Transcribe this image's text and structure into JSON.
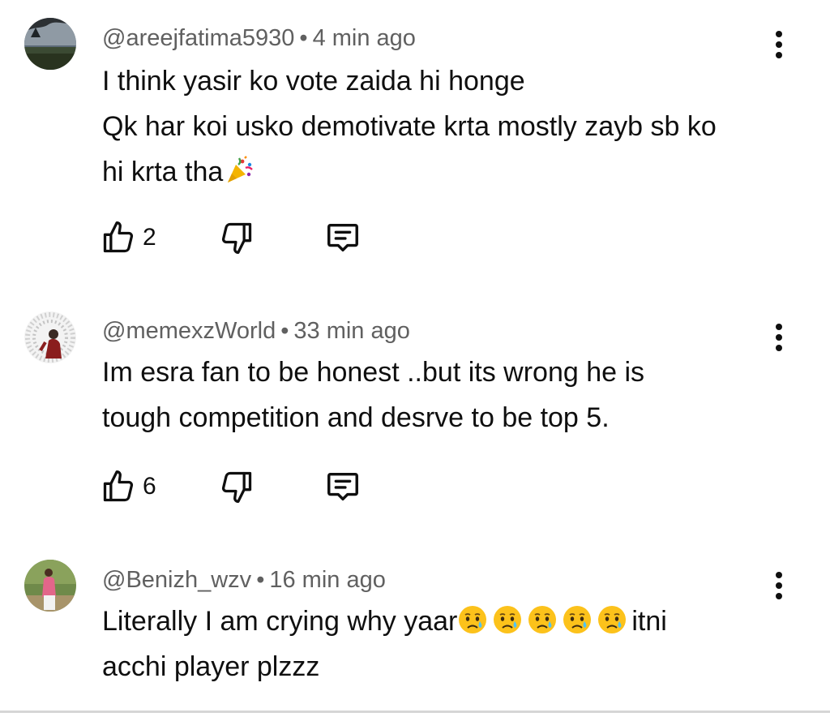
{
  "comments": [
    {
      "author": "@areejfatima5930",
      "time": "4 min ago",
      "lines": [
        "I think yasir ko vote zaida hi honge",
        "Qk har koi usko demotivate krta mostly zayb sb ko",
        "hi krta tha"
      ],
      "trailing_emoji": "party-popper",
      "likes": "2"
    },
    {
      "author": "@memexzWorld",
      "time": "33 min ago",
      "lines": [
        "Im esra fan to be honest ..but its wrong he is",
        "tough competition and desrve to be top 5."
      ],
      "likes": "6"
    },
    {
      "author": "@Benizh_wzv",
      "time": "16 min ago",
      "line1_before": "Literally I am crying why yaar",
      "line1_emoji": "crying-face",
      "line1_emoji_count": 5,
      "line1_after": "itni",
      "line2": "acchi player plzzz"
    }
  ],
  "separator": "•",
  "icons": {
    "more": "more-vertical-icon",
    "like": "thumbs-up-icon",
    "dislike": "thumbs-down-icon",
    "reply": "comment-icon"
  },
  "colors": {
    "text": "#0f0f0f",
    "meta": "#606060",
    "divider": "#d6d6d6"
  }
}
